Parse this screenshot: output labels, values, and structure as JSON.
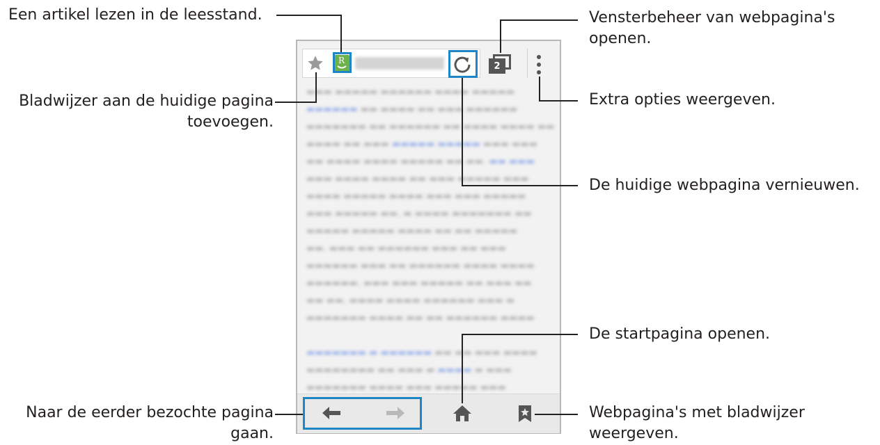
{
  "callouts": {
    "reader": "Een artikel lezen in de leesstand.",
    "bookmark_line1": "Bladwijzer aan de huidige pagina",
    "bookmark_line2": "toevoegen.",
    "previous_line1": "Naar de eerder bezochte pagina",
    "previous_line2": "gaan.",
    "windows_line1": "Vensterbeheer van webpagina's",
    "windows_line2": "openen.",
    "options": "Extra opties weergeven.",
    "refresh": "De huidige webpagina vernieuwen.",
    "home": "De startpagina openen.",
    "bookmarks_line1": "Webpagina's met bladwijzer",
    "bookmarks_line2": "weergeven."
  },
  "browser": {
    "tab_count": "2",
    "reader_icon_letter": "R"
  },
  "icons": [
    "star-icon",
    "reader-mode-icon",
    "refresh-icon",
    "tabs-icon",
    "more-options-icon",
    "back-arrow-icon",
    "forward-arrow-icon",
    "home-icon",
    "bookmark-icon"
  ],
  "colors": {
    "highlight": "#1c86c6",
    "reader_icon": "#6bb24a",
    "toolbar_icon": "#555555"
  }
}
